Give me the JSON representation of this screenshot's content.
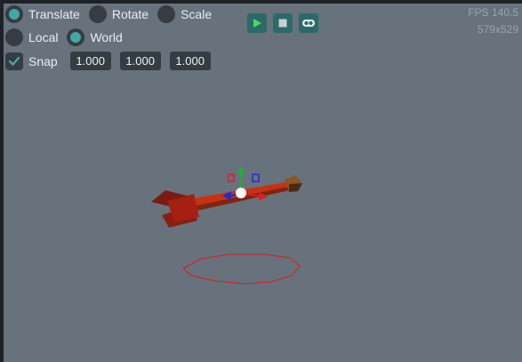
{
  "transform_modes": {
    "translate_label": "Translate",
    "rotate_label": "Rotate",
    "scale_label": "Scale",
    "selected": "translate"
  },
  "space_modes": {
    "local_label": "Local",
    "world_label": "World",
    "selected": "world"
  },
  "snap": {
    "label": "Snap",
    "enabled": true,
    "values": [
      "1.000",
      "1.000",
      "1.000"
    ]
  },
  "playback": {
    "play_icon": "play-icon",
    "stop_icon": "stop-icon",
    "camera_icon": "camera-icon"
  },
  "stats": {
    "fps": "FPS 140.5",
    "resolution": "579x529"
  },
  "colors": {
    "accent": "#42a8a6",
    "viewport_bg": "#67727d",
    "gizmo_x": "#e02020",
    "gizmo_y": "#20b020",
    "gizmo_z": "#2030e0"
  }
}
